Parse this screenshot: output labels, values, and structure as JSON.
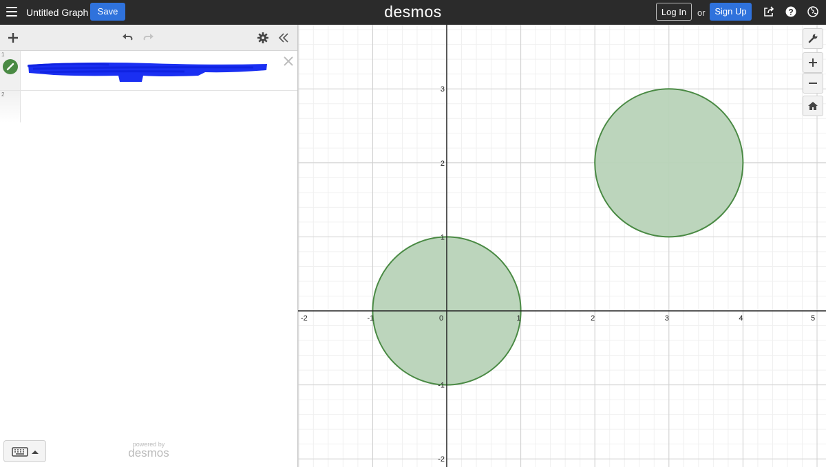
{
  "header": {
    "title": "Untitled Graph",
    "save_label": "Save",
    "brand": "desmos",
    "login_label": "Log In",
    "or_text": "or",
    "signup_label": "Sign Up"
  },
  "expressions": [
    {
      "index": "1",
      "color": "#4a8a44",
      "content": "redacted"
    },
    {
      "index": "2",
      "content": ""
    }
  ],
  "footer": {
    "powered_by": "powered by",
    "brand": "desmos"
  },
  "graph": {
    "x_ticks": [
      "-2",
      "-1",
      "0",
      "1",
      "2",
      "3",
      "4",
      "5"
    ],
    "y_ticks": [
      "3",
      "2",
      "1",
      "-1",
      "-2"
    ],
    "xlim": [
      -2,
      5
    ],
    "ylim": [
      -2,
      3
    ],
    "grid": true,
    "shapes": [
      {
        "type": "circle",
        "center": [
          0,
          0
        ],
        "radius": 1,
        "fill": "#b8d3b8",
        "stroke": "#4a8a44"
      },
      {
        "type": "circle",
        "center": [
          3,
          2
        ],
        "radius": 1,
        "fill": "#b8d3b8",
        "stroke": "#4a8a44"
      }
    ]
  }
}
